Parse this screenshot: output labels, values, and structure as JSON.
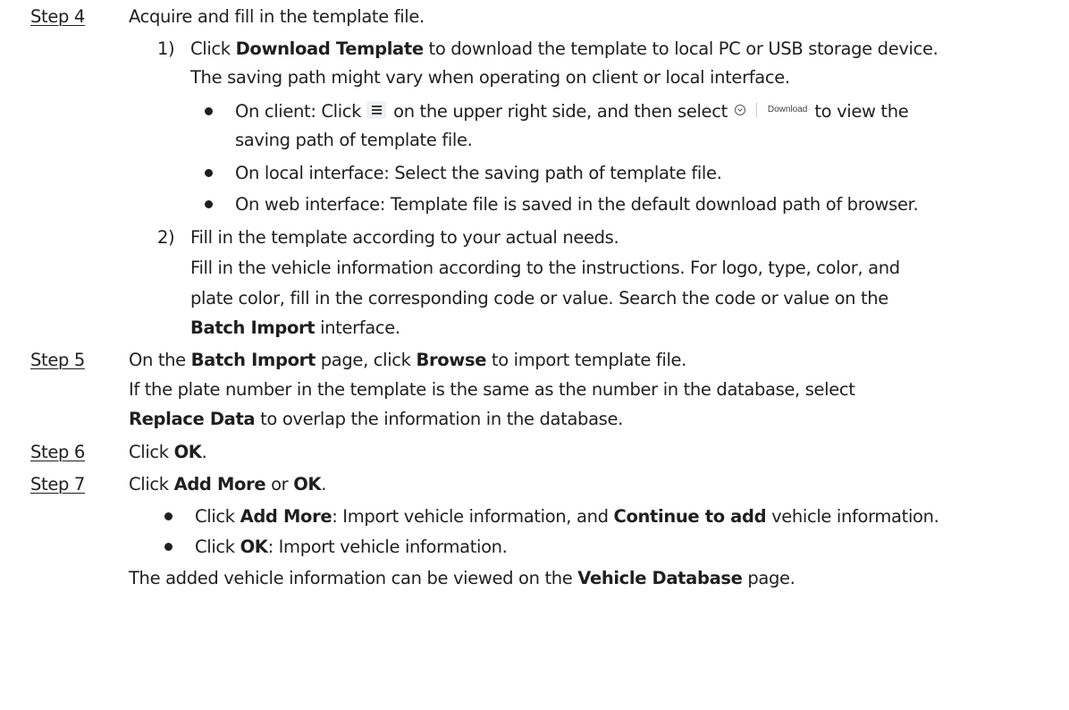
{
  "steps": {
    "s4": {
      "label": "Step 4",
      "text": "Acquire and fill in the template file.",
      "sub1": {
        "num": "1)",
        "pre": "Click ",
        "b1": "Download Template",
        "post": " to download the template to local PC or USB storage device.",
        "line2": "The saving path might vary when operating on client or local interface.",
        "bullets": {
          "b1_pre": "On client: Click ",
          "b1_mid": " on the upper right side, and then select ",
          "b1_post": " to view the",
          "b1_cont": "saving path of template file.",
          "download_chip_label": "Download",
          "b2": "On local interface: Select the saving path of template file.",
          "b3": "On web interface: Template file is saved in the default download path of browser."
        }
      },
      "sub2": {
        "num": "2)",
        "text": "Fill in the template according to your actual needs.",
        "p1": "Fill in the vehicle information according to the instructions. For logo, type, color, and",
        "p2": "plate color, fill in the corresponding code or value. Search the code or value on the",
        "p3_b": "Batch Import",
        "p3_post": " interface."
      }
    },
    "s5": {
      "label": "Step 5",
      "pre": "On the ",
      "b1": "Batch Import",
      "mid": " page, click ",
      "b2": "Browse",
      "post": " to import template file.",
      "l2": "If the plate number in the template is the same as the number in the database, select",
      "l3_b": "Replace Data",
      "l3_post": " to overlap the information in the database."
    },
    "s6": {
      "label": "Step 6",
      "pre": "Click ",
      "b1": "OK",
      "post": "."
    },
    "s7": {
      "label": "Step 7",
      "pre": "Click ",
      "b1": "Add More",
      "mid": " or ",
      "b2": "OK",
      "post": ".",
      "bullet1": {
        "pre": "Click ",
        "b1": "Add More",
        "mid": ": Import vehicle information, and ",
        "b2": "Continue to add",
        "post": " vehicle information."
      },
      "bullet2": {
        "pre": "Click ",
        "b1": "OK",
        "post": ": Import vehicle information."
      },
      "final_pre": "The added vehicle information can be viewed on the ",
      "final_b": "Vehicle Database",
      "final_post": " page."
    }
  }
}
